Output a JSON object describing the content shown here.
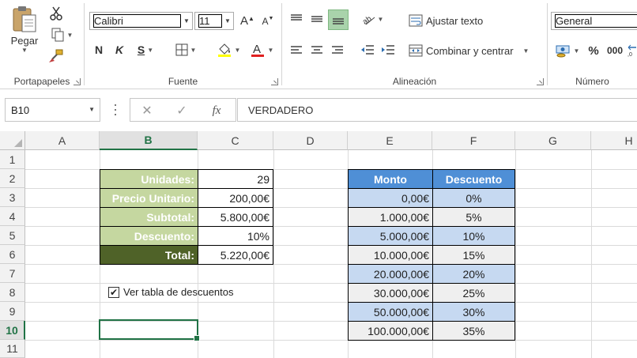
{
  "ribbon": {
    "clipboard": {
      "paste_label": "Pegar",
      "group_label": "Portapapeles"
    },
    "font": {
      "family": "Calibri",
      "size": "11",
      "bold": "N",
      "italic": "K",
      "underline": "S",
      "grow": "A",
      "shrink": "A",
      "group_label": "Fuente"
    },
    "alignment": {
      "wrap_text": "Ajustar texto",
      "merge_center": "Combinar y centrar",
      "group_label": "Alineación"
    },
    "number": {
      "format": "General",
      "percent": "%",
      "thousands": "000",
      "group_label": "Número"
    }
  },
  "formula_bar": {
    "name_box": "B10",
    "fx": "fx",
    "content": "VERDADERO"
  },
  "columns": [
    "A",
    "B",
    "C",
    "D",
    "E",
    "F",
    "G",
    "H"
  ],
  "rows": [
    "1",
    "2",
    "3",
    "4",
    "5",
    "6",
    "7",
    "8",
    "9",
    "10",
    "11"
  ],
  "selected": {
    "column": "B",
    "row": "10"
  },
  "summary": [
    {
      "label": "Unidades:",
      "value": "29"
    },
    {
      "label": "Precio Unitario:",
      "value": "200,00€"
    },
    {
      "label": "Subtotal:",
      "value": "5.800,00€"
    },
    {
      "label": "Descuento:",
      "value": "10%"
    },
    {
      "label": "Total:",
      "value": "5.220,00€"
    }
  ],
  "discount_table": {
    "headers": [
      "Monto",
      "Descuento"
    ],
    "rows": [
      [
        "0,00€",
        "0%"
      ],
      [
        "1.000,00€",
        "5%"
      ],
      [
        "5.000,00€",
        "10%"
      ],
      [
        "10.000,00€",
        "15%"
      ],
      [
        "20.000,00€",
        "20%"
      ],
      [
        "30.000,00€",
        "25%"
      ],
      [
        "50.000,00€",
        "30%"
      ],
      [
        "100.000,00€",
        "35%"
      ]
    ]
  },
  "checkbox": {
    "label": "Ver tabla de descuentos",
    "checked": true
  },
  "colors": {
    "label_light": "#c5d7a0",
    "label_dark": "#4f6228",
    "table_header": "#4f8fd6",
    "row_blue": "#c6d9f1",
    "row_grey": "#efefef",
    "excel_green": "#217346"
  }
}
